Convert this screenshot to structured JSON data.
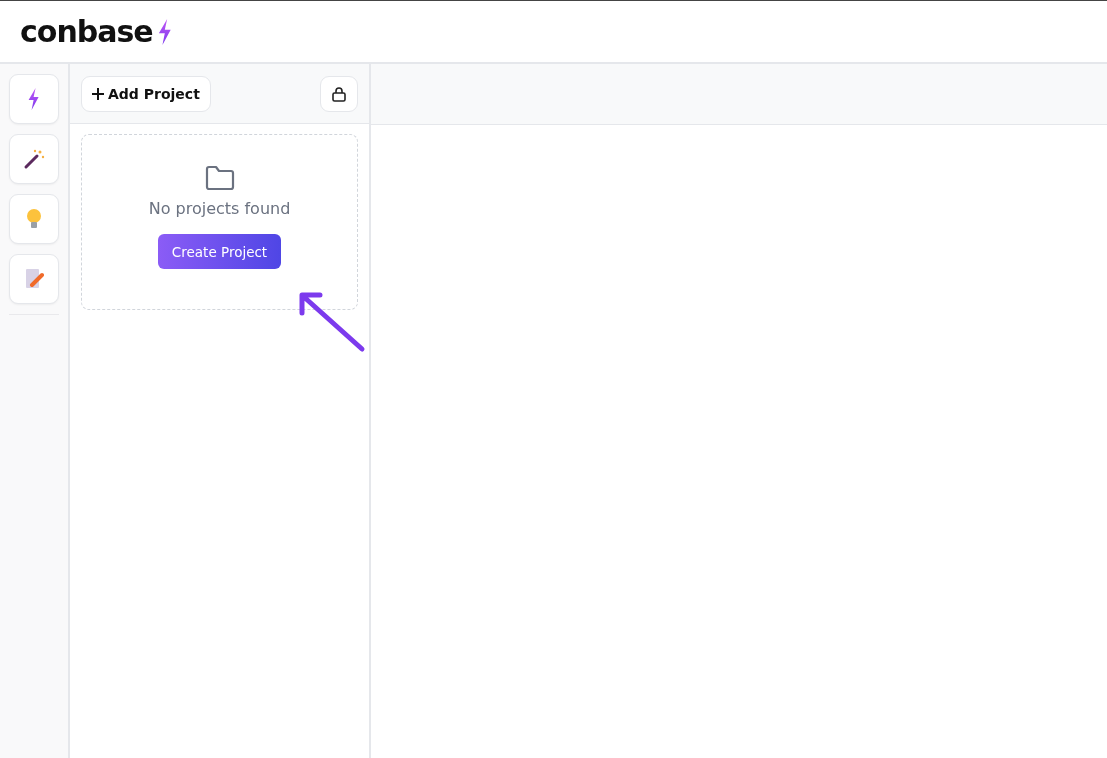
{
  "header": {
    "logo": "conbase"
  },
  "projects_panel": {
    "add_button": "Add Project",
    "empty_state": {
      "message": "No projects found",
      "button": "Create Project"
    }
  }
}
